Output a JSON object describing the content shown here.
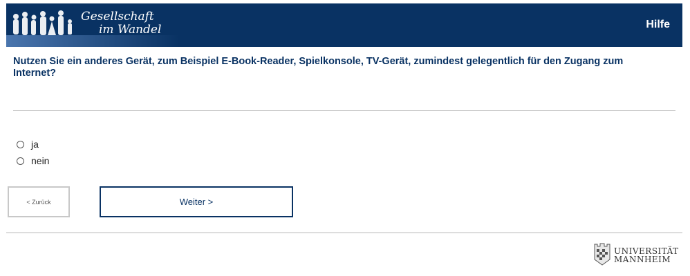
{
  "header": {
    "logo_line1": "Gesellschaft",
    "logo_line2": "im Wandel",
    "help_label": "Hilfe",
    "bg_color": "#093263"
  },
  "question": {
    "text": "Nutzen Sie ein anderes Gerät, zum Beispiel E-Book-Reader, Spielkonsole, TV-Gerät, zumindest gelegentlich für den Zugang zum Internet?"
  },
  "options": [
    {
      "label": "ja",
      "selected": false
    },
    {
      "label": "nein",
      "selected": false
    }
  ],
  "nav": {
    "back_label": "< Zurück",
    "next_label": "Weiter >"
  },
  "footer": {
    "uni_line1": "UNIVERSITÄT",
    "uni_line2": "MANNHEIM"
  }
}
